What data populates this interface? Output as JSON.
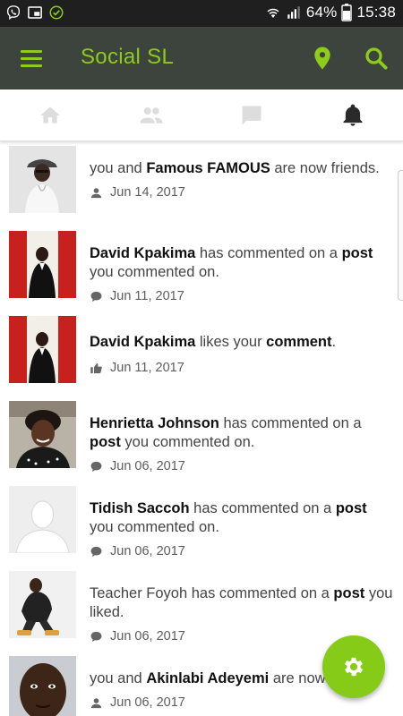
{
  "status_bar": {
    "left_icons": [
      "viber-icon",
      "picture-in-picture-icon",
      "check-circle-icon"
    ],
    "battery": "64%",
    "time": "15:38"
  },
  "app_bar": {
    "title": "Social SL",
    "accent_color": "#8dcc1a",
    "background": "#3d433d",
    "icons": [
      "menu-icon",
      "location-pin-icon",
      "search-icon"
    ]
  },
  "tabs": [
    {
      "name": "home",
      "icon": "home-icon",
      "active": false
    },
    {
      "name": "friends",
      "icon": "people-icon",
      "active": false
    },
    {
      "name": "messages",
      "icon": "chat-icon",
      "active": false
    },
    {
      "name": "notifications",
      "icon": "bell-icon",
      "active": true
    }
  ],
  "notifications": [
    {
      "pre": "you and ",
      "name": "Famous FAMOUS",
      "post": " are now friends.",
      "link": "",
      "tail": "",
      "date": "Jun 14, 2017",
      "meta_icon": "person-icon"
    },
    {
      "pre": "",
      "name": "David Kpakima",
      "post": " has commented on a ",
      "link": "post",
      "tail": " you commented on.",
      "date": "Jun 11, 2017",
      "meta_icon": "comment-icon"
    },
    {
      "pre": "",
      "name": "David Kpakima",
      "post": " likes your ",
      "link": "comment",
      "tail": ".",
      "date": "Jun 11, 2017",
      "meta_icon": "thumbs-up-icon"
    },
    {
      "pre": "",
      "name": "Henrietta Johnson",
      "post": " has commented on a ",
      "link": "post",
      "tail": " you commented on.",
      "date": "Jun 06, 2017",
      "meta_icon": "comment-icon"
    },
    {
      "pre": "",
      "name": "Tidish Saccoh",
      "post": " has commented on a ",
      "link": "post",
      "tail": " you commented on.",
      "date": "Jun 06, 2017",
      "meta_icon": "comment-icon"
    },
    {
      "pre": "Teacher Foyoh has commented on a ",
      "name": "",
      "post": "",
      "link": "post",
      "tail": " you liked.",
      "date": "Jun 06, 2017",
      "meta_icon": "comment-icon"
    },
    {
      "pre": "you and ",
      "name": "Akinlabi Adeyemi",
      "post": " are now friends.",
      "link": "",
      "tail": "",
      "date": "Jun 06, 2017",
      "meta_icon": "person-icon"
    }
  ],
  "fab": {
    "icon": "gear-icon",
    "color": "#86cb17"
  }
}
